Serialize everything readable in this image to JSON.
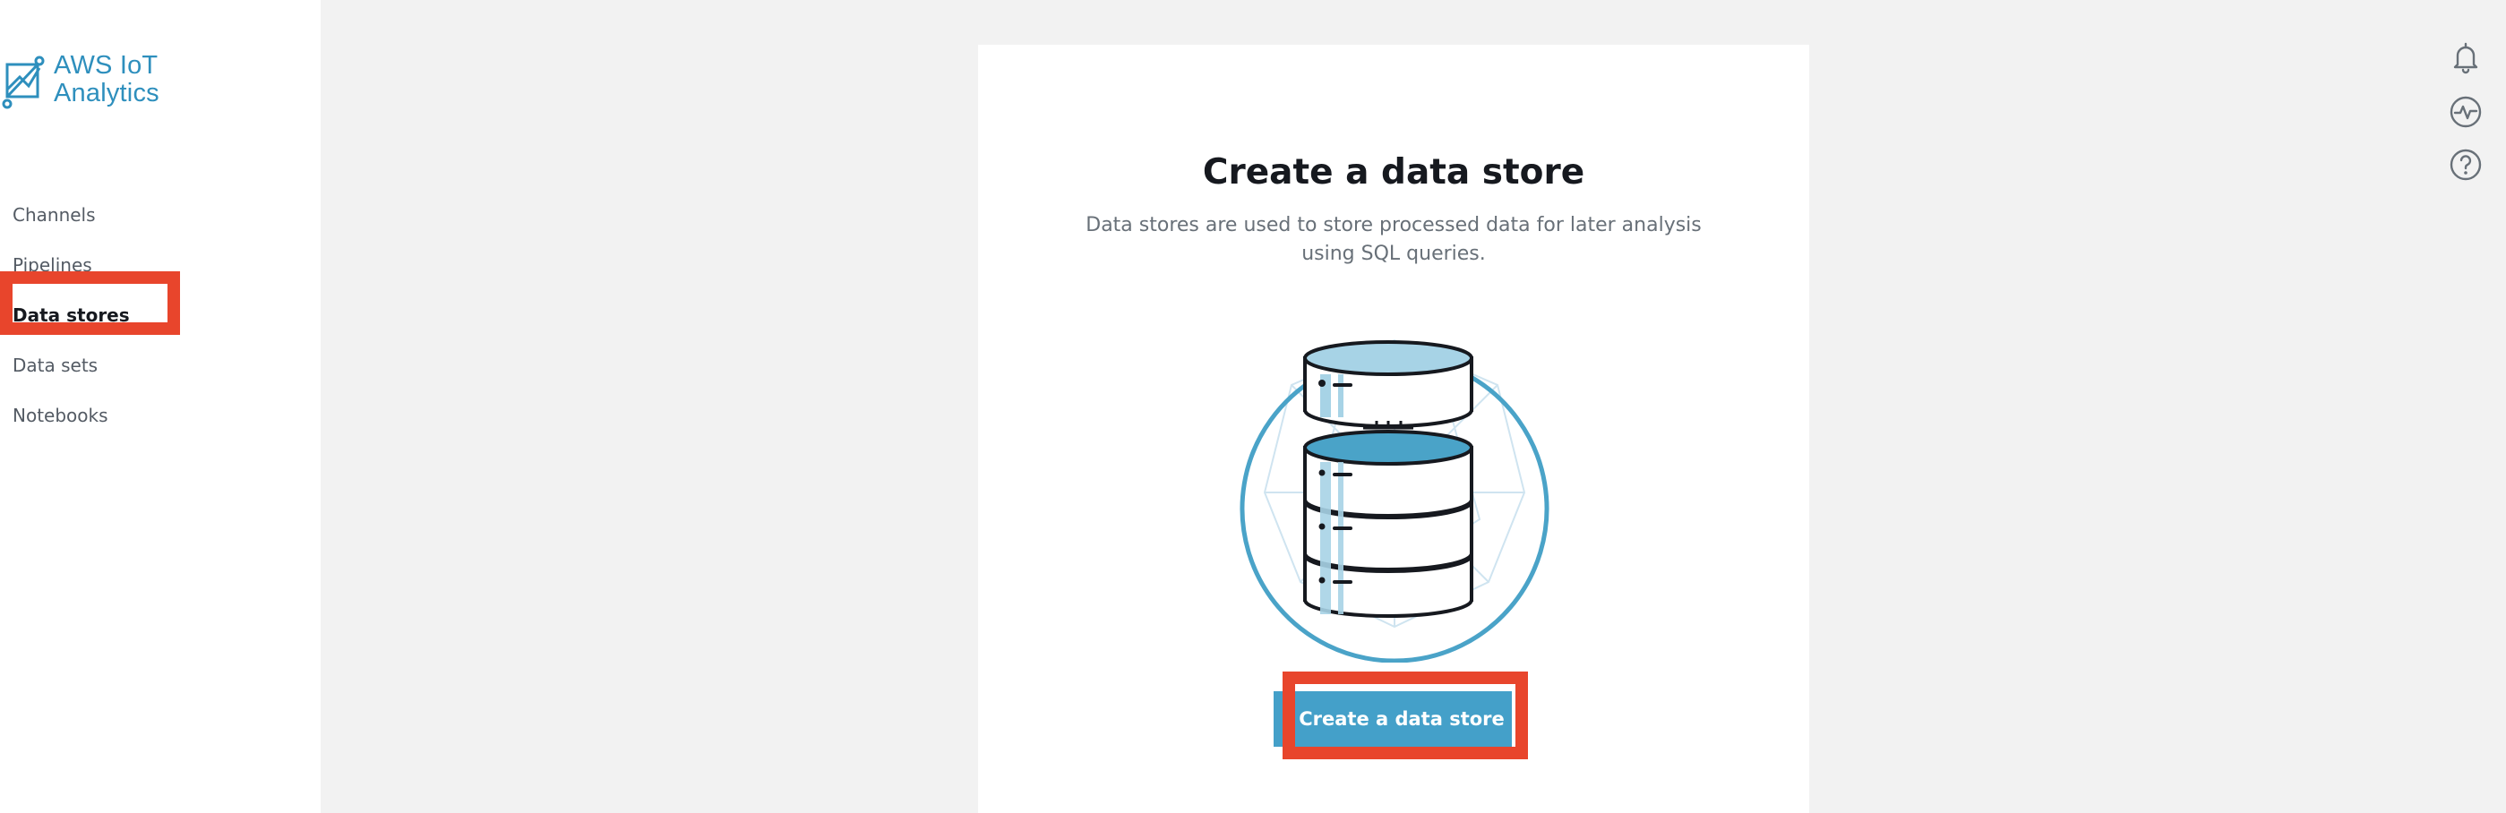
{
  "brand": {
    "title_line1": "AWS IoT",
    "title_line2": "Analytics",
    "icon": "iot-analytics-logo-icon"
  },
  "sidebar": {
    "items": [
      {
        "label": "Channels",
        "active": false
      },
      {
        "label": "Pipelines",
        "active": false
      },
      {
        "label": "Data stores",
        "active": true
      },
      {
        "label": "Data sets",
        "active": false
      },
      {
        "label": "Notebooks",
        "active": false
      }
    ]
  },
  "main": {
    "title": "Create a data store",
    "subtitle": "Data stores are used to store processed data for later analysis using SQL queries.",
    "illustration": "database-stack-illustration",
    "create_button_label": "Create a data store"
  },
  "utility_icons": [
    "bell-icon",
    "activity-icon",
    "help-icon"
  ],
  "colors": {
    "accent": "#44a0c9",
    "brand_text": "#2e8fbd",
    "highlight": "#e8452c",
    "background": "#f2f2f2"
  }
}
